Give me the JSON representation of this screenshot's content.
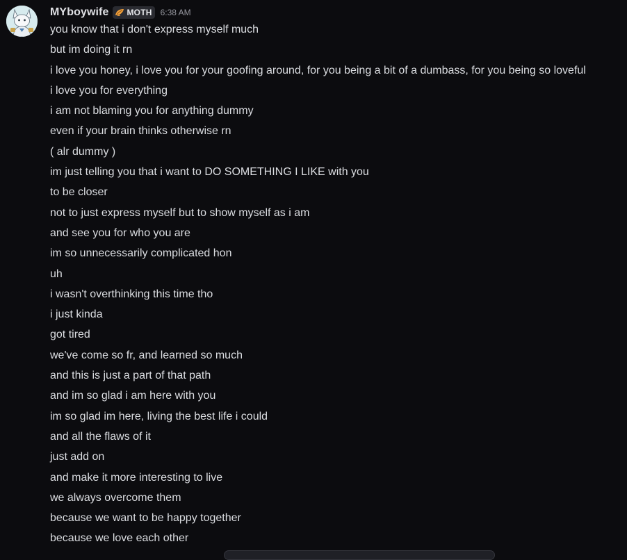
{
  "message": {
    "author": "MYboywife",
    "tag": {
      "label": "MOTH",
      "icon": "moth-wing-icon"
    },
    "timestamp": "6:38 AM",
    "avatar": {
      "icon": "white-fox-avatar-icon"
    },
    "lines": [
      "you know that i don't express myself much",
      "but im doing it rn",
      "i love you honey, i love you for your goofing around, for you being a bit of a dumbass, for you being so loveful",
      "i love you for everything",
      "i am not blaming you for anything dummy",
      "even if your brain thinks otherwise rn",
      "( alr dummy )",
      "im just telling you that i want to DO SOMETHING I LIKE with you",
      "to be closer",
      "not to just express myself but to show myself as i am",
      "and see you for who you are",
      "im so unnecessarily complicated hon",
      "uh",
      "i wasn't overthinking this time tho",
      "i just kinda",
      "got tired",
      "we've come so fr, and learned so much",
      "and this is just a part of that path",
      "and im so glad i am here with you",
      "im so glad im here, living the best life i could",
      "and all the flaws of it",
      "just add on",
      "and make it more interesting to live",
      "we always overcome them",
      "because we want to be happy together",
      "because we love each other"
    ]
  },
  "colors": {
    "background": "#0c0c0f",
    "text": "#dbdde1",
    "username": "#dfe0e4",
    "timestamp": "#96979f",
    "tag_bg": "#2a2b31",
    "tag_icon": "#f0a03c"
  }
}
